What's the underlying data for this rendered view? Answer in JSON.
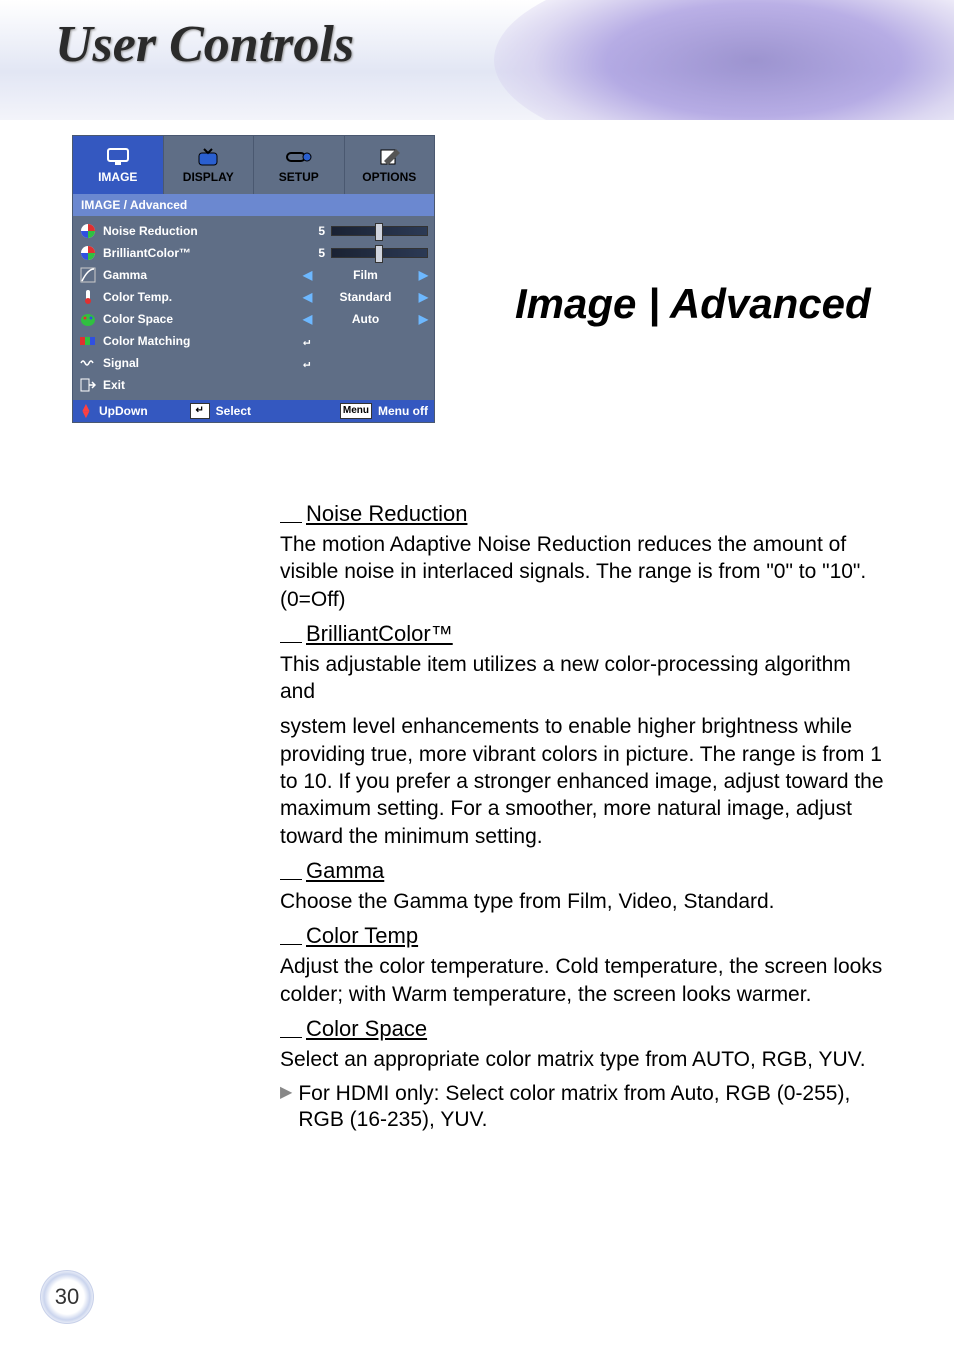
{
  "banner": {
    "title": "User Controls"
  },
  "section_title": "Image | Advanced",
  "osd": {
    "tabs": [
      {
        "label": "IMAGE",
        "active": true
      },
      {
        "label": "DISPLAY",
        "active": false
      },
      {
        "label": "SETUP",
        "active": false
      },
      {
        "label": "OPTIONS",
        "active": false
      }
    ],
    "breadcrumb": "IMAGE / Advanced",
    "rows": {
      "noise_reduction": {
        "label": "Noise Reduction",
        "value": "5",
        "slider_pct": 45
      },
      "brilliant_color": {
        "label": "BrilliantColor™",
        "value": "5",
        "slider_pct": 45
      },
      "gamma": {
        "label": "Gamma",
        "value": "Film"
      },
      "color_temp": {
        "label": "Color Temp.",
        "value": "Standard"
      },
      "color_space": {
        "label": "Color Space",
        "value": "Auto"
      },
      "color_matching": {
        "label": "Color Matching",
        "glyph": "↵"
      },
      "signal": {
        "label": "Signal",
        "glyph": "↵"
      },
      "exit": {
        "label": "Exit"
      }
    },
    "footer": {
      "updown": "UpDown",
      "select": "Select",
      "menu_key": "Menu",
      "menu_off": "Menu off"
    }
  },
  "content": {
    "nr_h": "Noise Reduction",
    "nr_p": "The motion Adaptive Noise Reduction reduces the amount of visible noise in interlaced signals. The range is from \"0\" to \"10\". (0=Off)",
    "bc_h": "BrilliantColor™",
    "bc_p1": "This adjustable item utilizes a new color-processing algorithm and",
    "bc_p2": "system level enhancements to enable higher brightness while providing true, more vibrant colors in picture. The range is from 1 to 10. If you prefer a stronger enhanced image, adjust toward the maximum setting. For a smoother, more natural image, adjust toward the minimum setting.",
    "gm_h": "Gamma",
    "gm_p": "Choose the Gamma type from Film, Video, Standard.",
    "ct_h": "Color Temp",
    "ct_p": "Adjust the color temperature. Cold temperature, the screen looks colder; with Warm temperature, the screen looks warmer.",
    "cs_h": "Color Space",
    "cs_p": "Select an appropriate color matrix type from AUTO, RGB, YUV.",
    "cs_sub": "For HDMI only: Select color matrix from Auto, RGB (0-255), RGB (16-235), YUV."
  },
  "page_number": "30"
}
